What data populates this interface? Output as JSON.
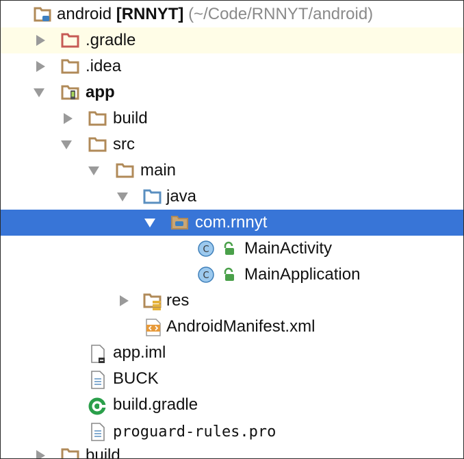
{
  "root": {
    "name": "android",
    "tag": "[RNNYT]",
    "path": "(~/Code/RNNYT/android)"
  },
  "items": {
    "gradle": ".gradle",
    "idea": ".idea",
    "app": "app",
    "build": "build",
    "src": "src",
    "main": "main",
    "java": "java",
    "package": "com.rnnyt",
    "main_activity": "MainActivity",
    "main_application": "MainApplication",
    "res": "res",
    "manifest": "AndroidManifest.xml",
    "app_iml": "app.iml",
    "buck": "BUCK",
    "build_gradle": "build.gradle",
    "proguard": "proguard-rules.pro",
    "build_root": "build"
  },
  "colors": {
    "selection": "#3875d7",
    "hover_row": "#fffde7",
    "folder": "#b08a58",
    "excluded_folder": "#c65a55",
    "source_folder": "#5a8fc0",
    "class_icon": "#9cc9ee",
    "lock_icon": "#4aa04a",
    "xml_icon": "#e79a3a",
    "gradle_icon": "#2a9f4a"
  },
  "icons": {
    "collapsed": "triangle-right-icon",
    "expanded": "triangle-down-icon",
    "folder": "folder-icon",
    "module": "module-folder-icon",
    "class": "class-icon",
    "file": "text-file-icon"
  }
}
